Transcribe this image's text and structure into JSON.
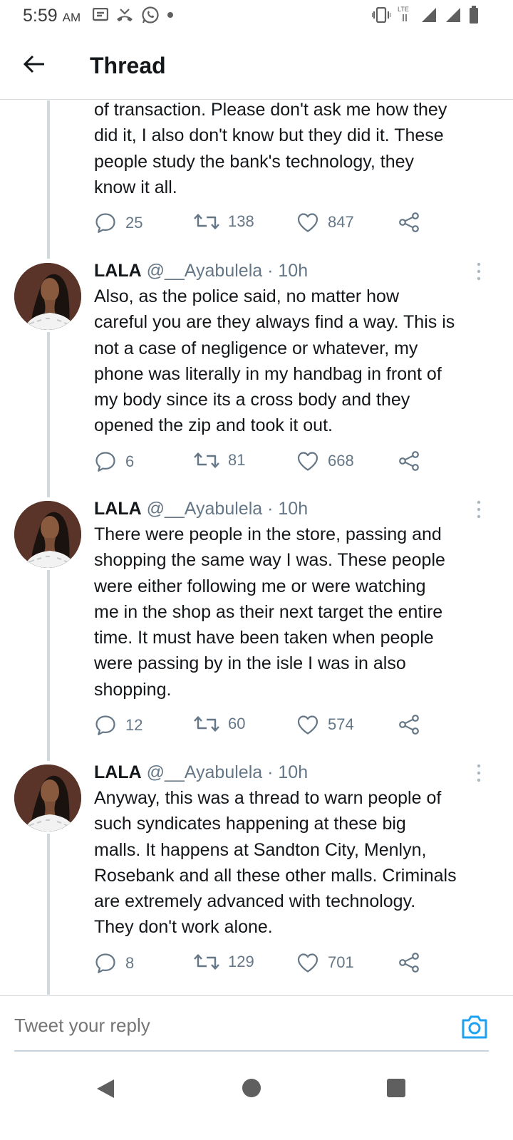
{
  "status_bar": {
    "time": "5:59",
    "ampm": "AM",
    "network": "LTE"
  },
  "header": {
    "title": "Thread"
  },
  "partial_tweet": {
    "lines": [
      "of transaction. Please don't ask me how they",
      "did it, I also don't know but they did it. These",
      "people study the bank's technology, they",
      "know it all."
    ],
    "replies": "25",
    "retweets": "138",
    "likes": "847"
  },
  "tweets": [
    {
      "name": "LALA",
      "handle": "@__Ayabulela",
      "time": "· 10h",
      "lines": [
        "Also, as the police said, no matter how",
        "careful you are they always find a way. This is",
        "not a case of negligence or whatever, my",
        "phone was literally in my handbag in front of",
        "my body since its a cross body and they",
        "opened the zip and took it out."
      ],
      "replies": "6",
      "retweets": "81",
      "likes": "668"
    },
    {
      "name": "LALA",
      "handle": "@__Ayabulela",
      "time": "· 10h",
      "lines": [
        "There were people in the store, passing and",
        "shopping the same way I was. These people",
        "were either following me or were watching",
        "me in the shop as their next target the entire",
        "time. It must have been taken when people",
        "were passing by in the isle I was in also",
        "shopping."
      ],
      "replies": "12",
      "retweets": "60",
      "likes": "574"
    },
    {
      "name": "LALA",
      "handle": "@__Ayabulela",
      "time": "· 10h",
      "lines": [
        "Anyway, this was a thread to warn people of",
        "such syndicates happening at these big",
        "malls. It happens at Sandton City, Menlyn,",
        "Rosebank and all these other malls. Criminals",
        "are extremely advanced with technology.",
        "They don't work alone."
      ],
      "replies": "8",
      "retweets": "129",
      "likes": "701"
    }
  ],
  "reply_bar": {
    "placeholder": "Tweet your reply"
  },
  "icons": {
    "action_color": "#657786",
    "accent": "#1da1f2"
  }
}
